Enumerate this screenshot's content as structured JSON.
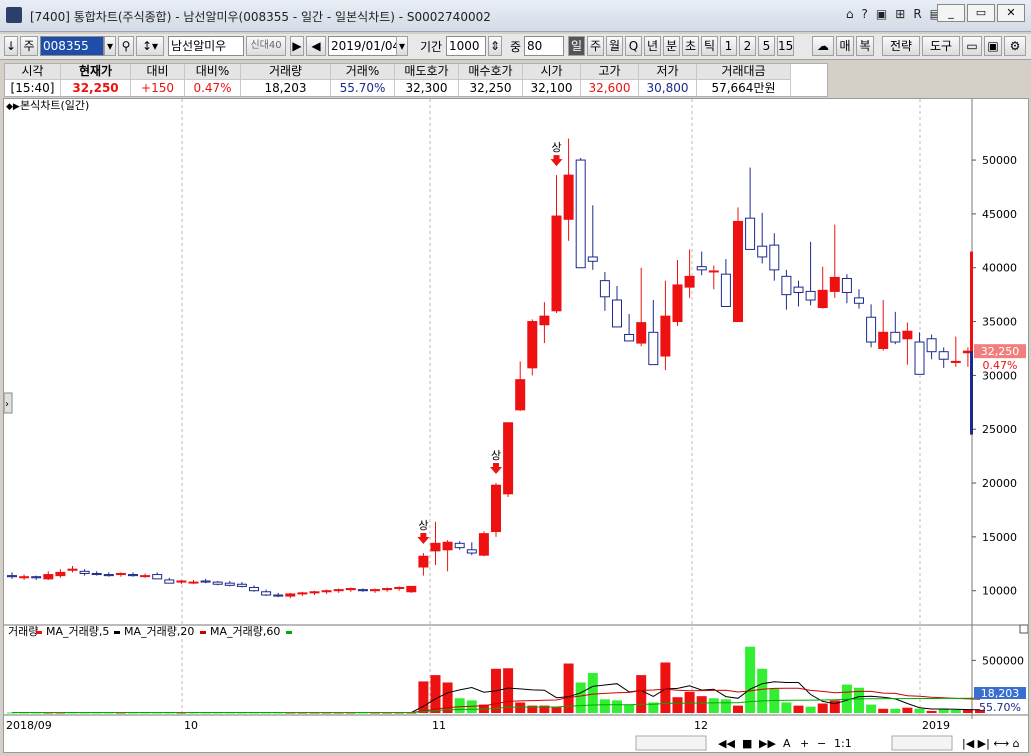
{
  "window": {
    "title": "[7400] 통합차트(주식종합) - 남선알미우(008355 - 일간 - 일본식차트) - S0002740002",
    "titlebar_icons": [
      "chat-icon",
      "help-icon",
      "layout-icon",
      "R",
      "pin-icon"
    ],
    "buttons": {
      "minimize": "_",
      "restore": "▭",
      "close": "✕"
    }
  },
  "toolbar": {
    "stock_code": "008355",
    "stock_name": "남선알미우",
    "date": "2019/01/04",
    "period_label": "기간",
    "period_value": "1000",
    "zoom_label": "중",
    "zoom_value": "80",
    "interval_buttons": [
      "일",
      "주",
      "월",
      "Q",
      "년",
      "분",
      "초",
      "틱",
      "1",
      "2",
      "5",
      "15"
    ],
    "right_buttons": [
      "매",
      "복",
      "전략",
      "도구"
    ]
  },
  "quote": {
    "headers": [
      "시각",
      "현재가",
      "대비",
      "대비%",
      "거래량",
      "거래%",
      "매도호가",
      "매수호가",
      "시가",
      "고가",
      "저가",
      "거래대금"
    ],
    "values": [
      "[15:40]",
      "32,250",
      "+150",
      "0.47%",
      "18,203",
      "55.70%",
      "32,300",
      "32,250",
      "32,100",
      "32,600",
      "30,800",
      "57,664만원"
    ]
  },
  "price_panel": {
    "label": "본식차트(일간)",
    "last_price": "32,250",
    "change_pct": "0.47%",
    "signal_label": "상"
  },
  "volume_panel": {
    "legend": [
      "거래량",
      "MA_거래량,5",
      "MA_거래량,20",
      "MA_거래량,60"
    ],
    "last_volume": "18,203",
    "volume_pct": "55.70%"
  },
  "colors": {
    "up": "#ee1111",
    "down": "#1c2a8c",
    "vol_up": "#ee1111",
    "vol_down": "#33ee33",
    "ma5": "#000000",
    "ma20": "#cc0000",
    "ma60": "#00aa00"
  },
  "chart_data": [
    {
      "type": "candlestick",
      "title": "본식차트(일간)",
      "x_labels": [
        "2018/09",
        "10",
        "11",
        "12",
        "2019"
      ],
      "ylim": [
        7000,
        54000
      ],
      "y_ticks": [
        10000,
        15000,
        20000,
        25000,
        30000,
        35000,
        40000,
        45000,
        50000
      ],
      "candles": [
        [
          11400,
          11700,
          11100,
          11300
        ],
        [
          11200,
          11500,
          11000,
          11300
        ],
        [
          11300,
          11400,
          11000,
          11200
        ],
        [
          11100,
          11800,
          11000,
          11500
        ],
        [
          11400,
          12000,
          11200,
          11700
        ],
        [
          11900,
          12300,
          11700,
          12000
        ],
        [
          11800,
          12000,
          11400,
          11600
        ],
        [
          11600,
          11800,
          11400,
          11500
        ],
        [
          11500,
          11700,
          11300,
          11400
        ],
        [
          11500,
          11700,
          11300,
          11600
        ],
        [
          11500,
          11700,
          11300,
          11400
        ],
        [
          11400,
          11600,
          11200,
          11400
        ],
        [
          11500,
          11700,
          11100,
          11100
        ],
        [
          11000,
          11200,
          10700,
          10700
        ],
        [
          10800,
          11000,
          10600,
          10900
        ],
        [
          10800,
          11000,
          10600,
          10800
        ],
        [
          10900,
          11100,
          10700,
          10800
        ],
        [
          10800,
          10900,
          10500,
          10600
        ],
        [
          10700,
          10900,
          10400,
          10500
        ],
        [
          10600,
          10800,
          10300,
          10400
        ],
        [
          10300,
          10500,
          9900,
          10000
        ],
        [
          9900,
          10100,
          9500,
          9600
        ],
        [
          9600,
          9800,
          9400,
          9500
        ],
        [
          9500,
          9800,
          9300,
          9700
        ],
        [
          9700,
          9900,
          9500,
          9800
        ],
        [
          9800,
          10000,
          9600,
          9900
        ],
        [
          9900,
          10100,
          9700,
          10000
        ],
        [
          10000,
          10200,
          9800,
          10100
        ],
        [
          10100,
          10300,
          9900,
          10200
        ],
        [
          10100,
          10200,
          9900,
          10000
        ],
        [
          10000,
          10200,
          9800,
          10100
        ],
        [
          10100,
          10300,
          9900,
          10200
        ],
        [
          10200,
          10400,
          10000,
          10300
        ],
        [
          9900,
          10400,
          9800,
          10400
        ],
        [
          12200,
          13500,
          11400,
          13200
        ],
        [
          13700,
          16400,
          12400,
          14400
        ],
        [
          13800,
          14700,
          11800,
          14500
        ],
        [
          14400,
          14600,
          13800,
          14000
        ],
        [
          13800,
          14500,
          13300,
          13500
        ],
        [
          13300,
          15500,
          13200,
          15300
        ],
        [
          15500,
          20000,
          15000,
          19800
        ],
        [
          19000,
          25600,
          18700,
          25600
        ],
        [
          26800,
          31300,
          26700,
          29600
        ],
        [
          30700,
          35200,
          30000,
          35000
        ],
        [
          34700,
          36800,
          33000,
          35500
        ],
        [
          36000,
          48600,
          35800,
          44800
        ],
        [
          44500,
          52000,
          42500,
          48600
        ],
        [
          50000,
          50200,
          40000,
          40000
        ],
        [
          41000,
          45800,
          39800,
          40600
        ],
        [
          38800,
          39600,
          36000,
          37300
        ],
        [
          37000,
          38300,
          34900,
          34500
        ],
        [
          33800,
          35700,
          33300,
          33200
        ],
        [
          33000,
          40000,
          32700,
          34900
        ],
        [
          34000,
          37000,
          31000,
          31000
        ],
        [
          31800,
          38800,
          30500,
          35500
        ],
        [
          35000,
          40700,
          34600,
          38400
        ],
        [
          38200,
          41700,
          37200,
          39200
        ],
        [
          40100,
          41500,
          39300,
          39800
        ],
        [
          39700,
          40200,
          38000,
          39700
        ],
        [
          39400,
          40800,
          38600,
          36400
        ],
        [
          35000,
          45600,
          35000,
          44300
        ],
        [
          44600,
          49300,
          42800,
          41700
        ],
        [
          42000,
          45100,
          40400,
          41000
        ],
        [
          42100,
          43200,
          38800,
          39800
        ],
        [
          39200,
          39800,
          36100,
          37500
        ],
        [
          38200,
          38800,
          36400,
          37700
        ],
        [
          37800,
          42400,
          36500,
          37000
        ],
        [
          36300,
          40100,
          36200,
          37900
        ],
        [
          37800,
          44000,
          37200,
          39100
        ],
        [
          39000,
          39400,
          36700,
          37700
        ],
        [
          37200,
          38000,
          36200,
          36700
        ],
        [
          35400,
          36600,
          32600,
          33100
        ],
        [
          32500,
          37000,
          32300,
          34000
        ],
        [
          34000,
          35900,
          32900,
          33100
        ],
        [
          33400,
          34900,
          31000,
          34100
        ],
        [
          33100,
          34000,
          30100,
          30100
        ],
        [
          33400,
          33800,
          31500,
          32200
        ],
        [
          32200,
          32600,
          30700,
          31500
        ],
        [
          31200,
          33600,
          30800,
          31300
        ],
        [
          32100,
          32600,
          30800,
          32250
        ]
      ]
    },
    {
      "type": "bar",
      "title": "거래량",
      "y_ticks": [
        500000
      ],
      "ylim": [
        0,
        760000
      ],
      "volumes": [
        5000,
        5000,
        5000,
        5000,
        5000,
        5000,
        5000,
        5000,
        5000,
        5000,
        5000,
        5000,
        5000,
        5000,
        5000,
        5000,
        5000,
        5000,
        5000,
        5000,
        5000,
        5000,
        5000,
        5000,
        5000,
        5000,
        5000,
        5000,
        5000,
        5000,
        5000,
        5000,
        5000,
        5000,
        300000,
        360000,
        290000,
        140000,
        120000,
        80000,
        420000,
        425000,
        100000,
        70000,
        70000,
        60000,
        470000,
        290000,
        380000,
        130000,
        120000,
        80000,
        360000,
        100000,
        480000,
        150000,
        200000,
        160000,
        140000,
        130000,
        70000,
        630000,
        420000,
        230000,
        100000,
        70000,
        60000,
        90000,
        120000,
        270000,
        240000,
        80000,
        40000,
        40000,
        50000,
        40000,
        20000,
        40000,
        30000,
        30000,
        30000
      ],
      "vol_up": [
        false,
        false,
        false,
        true,
        true,
        false,
        false,
        false,
        false,
        true,
        false,
        false,
        false,
        false,
        true,
        false,
        false,
        false,
        false,
        false,
        false,
        false,
        false,
        true,
        true,
        true,
        true,
        true,
        true,
        false,
        true,
        true,
        true,
        true,
        true,
        true,
        true,
        false,
        false,
        true,
        true,
        true,
        true,
        true,
        true,
        true,
        true,
        false,
        false,
        false,
        false,
        false,
        true,
        false,
        true,
        true,
        true,
        true,
        false,
        false,
        true,
        false,
        false,
        false,
        false,
        true,
        false,
        true,
        true,
        false,
        false,
        false,
        true,
        false,
        true,
        false,
        true,
        false,
        false,
        true,
        true
      ]
    }
  ]
}
